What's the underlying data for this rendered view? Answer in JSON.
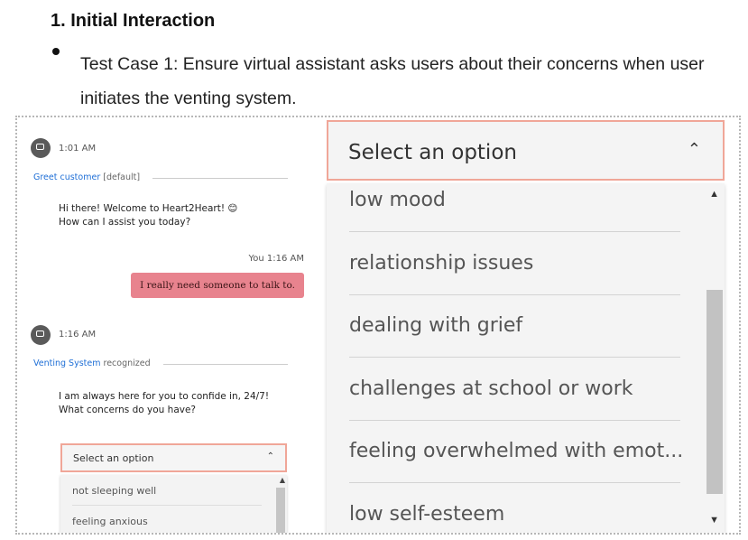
{
  "doc": {
    "heading": "1.  Initial Interaction",
    "bullet": "Test Case 1: Ensure virtual assistant asks users about their concerns when user initiates the venting system."
  },
  "chat": {
    "first": {
      "time": "1:01 AM",
      "intent": "Greet customer",
      "intent_suffix": " [default]",
      "line1": "Hi there! Welcome to Heart2Heart! 😊",
      "line2": "How can I assist you today?"
    },
    "user": {
      "time": "You 1:16 AM",
      "message": "I really need someone to talk to."
    },
    "second": {
      "time": "1:16 AM",
      "intent": "Venting System",
      "intent_suffix": " recognized",
      "line1": "I am always here for you to confide in, 24/7!",
      "line2": "What concerns do you have?"
    },
    "small_select": {
      "label": "Select an option",
      "options": [
        "not sleeping well",
        "feeling anxious"
      ]
    }
  },
  "big_select": {
    "label": "Select an option",
    "options": [
      "low mood",
      "relationship issues",
      "dealing with grief",
      "challenges at school or work",
      "feeling overwhelmed with emot...",
      "low self-esteem"
    ]
  },
  "colors": {
    "accent_border": "#f0a698",
    "user_bubble": "#e8838e",
    "intent_link": "#1f6fd6"
  }
}
